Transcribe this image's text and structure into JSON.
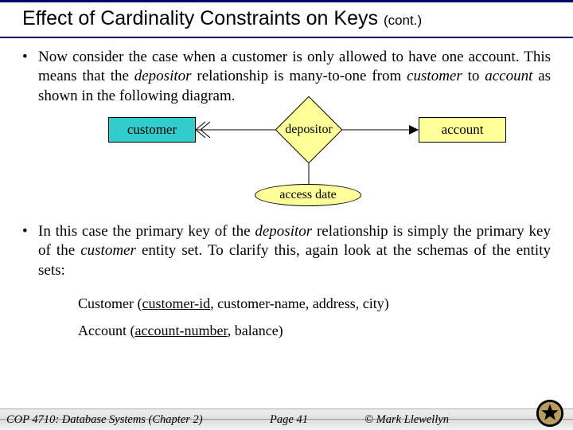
{
  "title": {
    "main": "Effect of Cardinality Constraints on Keys",
    "cont": "(cont.)"
  },
  "bullets": {
    "b1_a": "Now consider the case when a customer is only allowed to have one account.  This means that the ",
    "b1_b": "depositor",
    "b1_c": " relationship is many-to-one from ",
    "b1_d": "customer",
    "b1_e": " to ",
    "b1_f": "account",
    "b1_g": " as shown in the following diagram.",
    "b2_a": "In this case the primary key of the ",
    "b2_b": "depositor",
    "b2_c": " relationship is simply the primary key of the ",
    "b2_d": "customer",
    "b2_e": " entity set.  To clarify this, again look at the schemas of the entity sets:"
  },
  "diagram": {
    "customer": "customer",
    "depositor": "depositor",
    "account": "account",
    "access_date": "access date"
  },
  "schemas": {
    "s1_a": "Customer (",
    "s1_b": "customer-id",
    "s1_c": ", customer-name, address, city)",
    "s2_a": "Account (",
    "s2_b": "account-number",
    "s2_c": ", balance)"
  },
  "footer": {
    "left": "COP 4710: Database Systems  (Chapter 2)",
    "mid": "Page 41",
    "right": "© Mark Llewellyn"
  }
}
